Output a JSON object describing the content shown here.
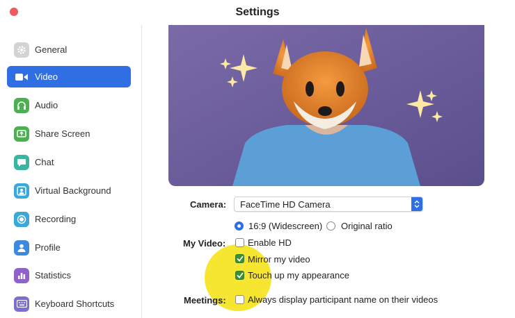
{
  "window": {
    "title": "Settings"
  },
  "sidebar": {
    "items": [
      {
        "label": "General",
        "icon": "gear-icon",
        "color": "#c9c9c9",
        "active": false
      },
      {
        "label": "Video",
        "icon": "video-camera-icon",
        "color": "#2f6ee3",
        "active": true
      },
      {
        "label": "Audio",
        "icon": "headphones-icon",
        "color": "#4caf50",
        "active": false
      },
      {
        "label": "Share Screen",
        "icon": "share-screen-icon",
        "color": "#4caf50",
        "active": false
      },
      {
        "label": "Chat",
        "icon": "chat-bubble-icon",
        "color": "#38b6a0",
        "active": false
      },
      {
        "label": "Virtual Background",
        "icon": "person-portrait-icon",
        "color": "#3aa8d8",
        "active": false
      },
      {
        "label": "Recording",
        "icon": "record-icon",
        "color": "#3aa8d8",
        "active": false
      },
      {
        "label": "Profile",
        "icon": "person-icon",
        "color": "#3a8be0",
        "active": false
      },
      {
        "label": "Statistics",
        "icon": "bar-chart-icon",
        "color": "#8f62c9",
        "active": false
      },
      {
        "label": "Keyboard Shortcuts",
        "icon": "keyboard-icon",
        "color": "#7a6fd1",
        "active": false
      }
    ]
  },
  "camera": {
    "label": "Camera:",
    "selected": "FaceTime HD Camera"
  },
  "aspect": {
    "widescreen": "16:9 (Widescreen)",
    "widescreen_selected": true,
    "original": "Original ratio",
    "original_selected": false
  },
  "my_video": {
    "label": "My Video:",
    "enable_hd": {
      "label": "Enable HD",
      "checked": false
    },
    "mirror": {
      "label": "Mirror my video",
      "checked": true
    },
    "touch_up": {
      "label": "Touch up my appearance",
      "checked": true
    }
  },
  "meetings": {
    "label": "Meetings:",
    "display_name": {
      "label": "Always display participant name on their videos",
      "checked": false
    }
  },
  "colors": {
    "accent": "#2f6ee3",
    "check_on": "#3d8f2f",
    "highlight": "#f7e526",
    "preview_bg": "#6b5b9a"
  }
}
